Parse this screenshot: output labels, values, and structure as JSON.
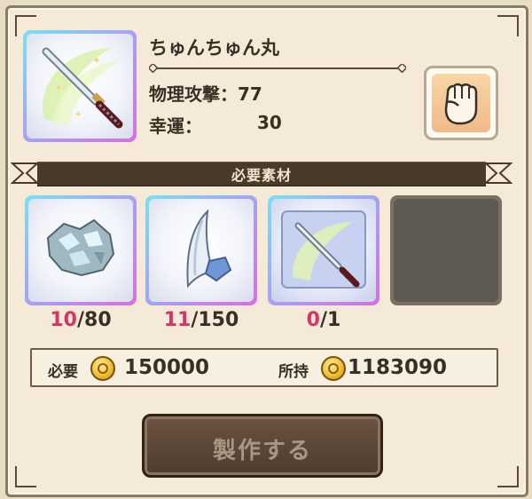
{
  "item": {
    "name": "ちゅんちゅん丸",
    "stats": [
      {
        "label": "物理攻撃：",
        "value": "77"
      },
      {
        "label": "幸運：",
        "value": "30"
      }
    ]
  },
  "section": {
    "title": "必要素材"
  },
  "materials": [
    {
      "have": "10",
      "need": "/80",
      "icon": "crystal-ore-icon"
    },
    {
      "have": "11",
      "need": "/150",
      "icon": "claw-fang-icon"
    },
    {
      "have": "0",
      "need": "/1",
      "icon": "katana-scroll-icon"
    }
  ],
  "cost": {
    "required_label": "必要",
    "required_value": "150000",
    "owned_label": "所持",
    "owned_value": "1183090"
  },
  "craft_button": {
    "label": "製作する"
  },
  "colors": {
    "accent_pink": "#d6336b",
    "panel": "#f4ead7",
    "banner": "#4a3a2c"
  }
}
